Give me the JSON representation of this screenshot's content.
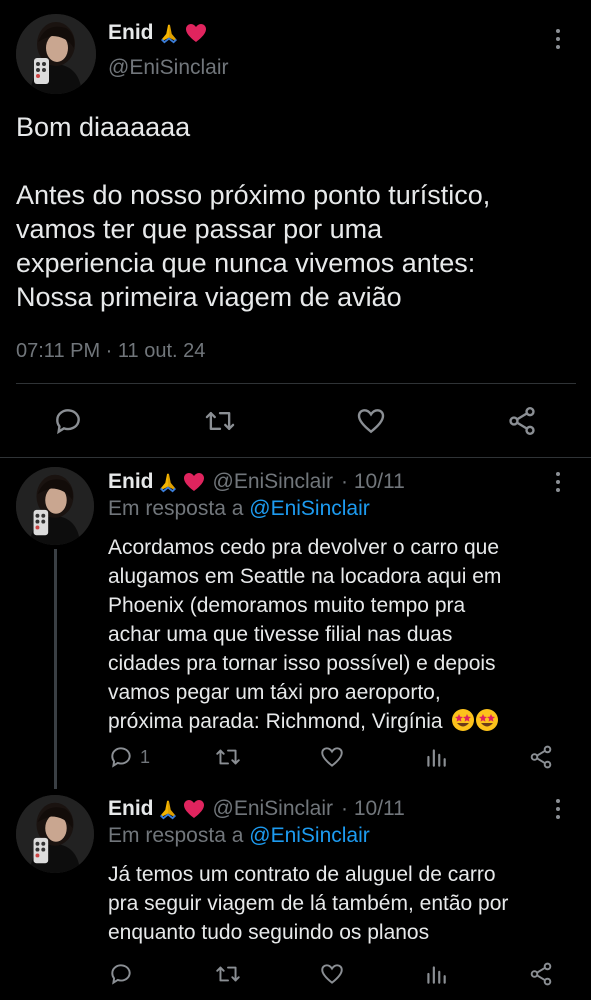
{
  "main_tweet": {
    "display_name": "Enid",
    "handle": "@EniSinclair",
    "text": "Bom diaaaaaa\n\nAntes do nosso próximo ponto turístico,\nvamos ter que passar por uma\nexperiencia que nunca vivemos antes:\nNossa primeira viagem de avião",
    "timestamp": "07:11 PM · 11 out. 24",
    "actions": [
      "reply",
      "retweet",
      "like",
      "share"
    ]
  },
  "replies": [
    {
      "display_name": "Enid",
      "handle": "@EniSinclair",
      "date": "· 10/11",
      "reply_prefix": "Em resposta a",
      "reply_to": "@EniSinclair",
      "text": "Acordamos cedo pra devolver o carro que\nalugamos em Seattle na locadora aqui em\nPhoenix (demoramos muito tempo pra\nachar uma que tivesse filial nas duas\ncidades pra tornar isso possível) e depois\nvamos pegar um táxi pro aeroporto,\npróxima parada: Richmond, Virgínia",
      "reply_count": "1"
    },
    {
      "display_name": "Enid",
      "handle": "@EniSinclair",
      "date": "· 10/11",
      "reply_prefix": "Em resposta a",
      "reply_to": "@EniSinclair",
      "text": "Já temos um contrato de aluguel de carro\npra seguir viagem de lá também, então por\nenquanto tudo seguindo os planos",
      "reply_count": ""
    }
  ],
  "colors": {
    "background": "#000000",
    "text": "#e7e9ea",
    "muted": "#71767b",
    "link": "#1d9bf0",
    "heart": "#e0245e",
    "divider": "#2f3336"
  }
}
